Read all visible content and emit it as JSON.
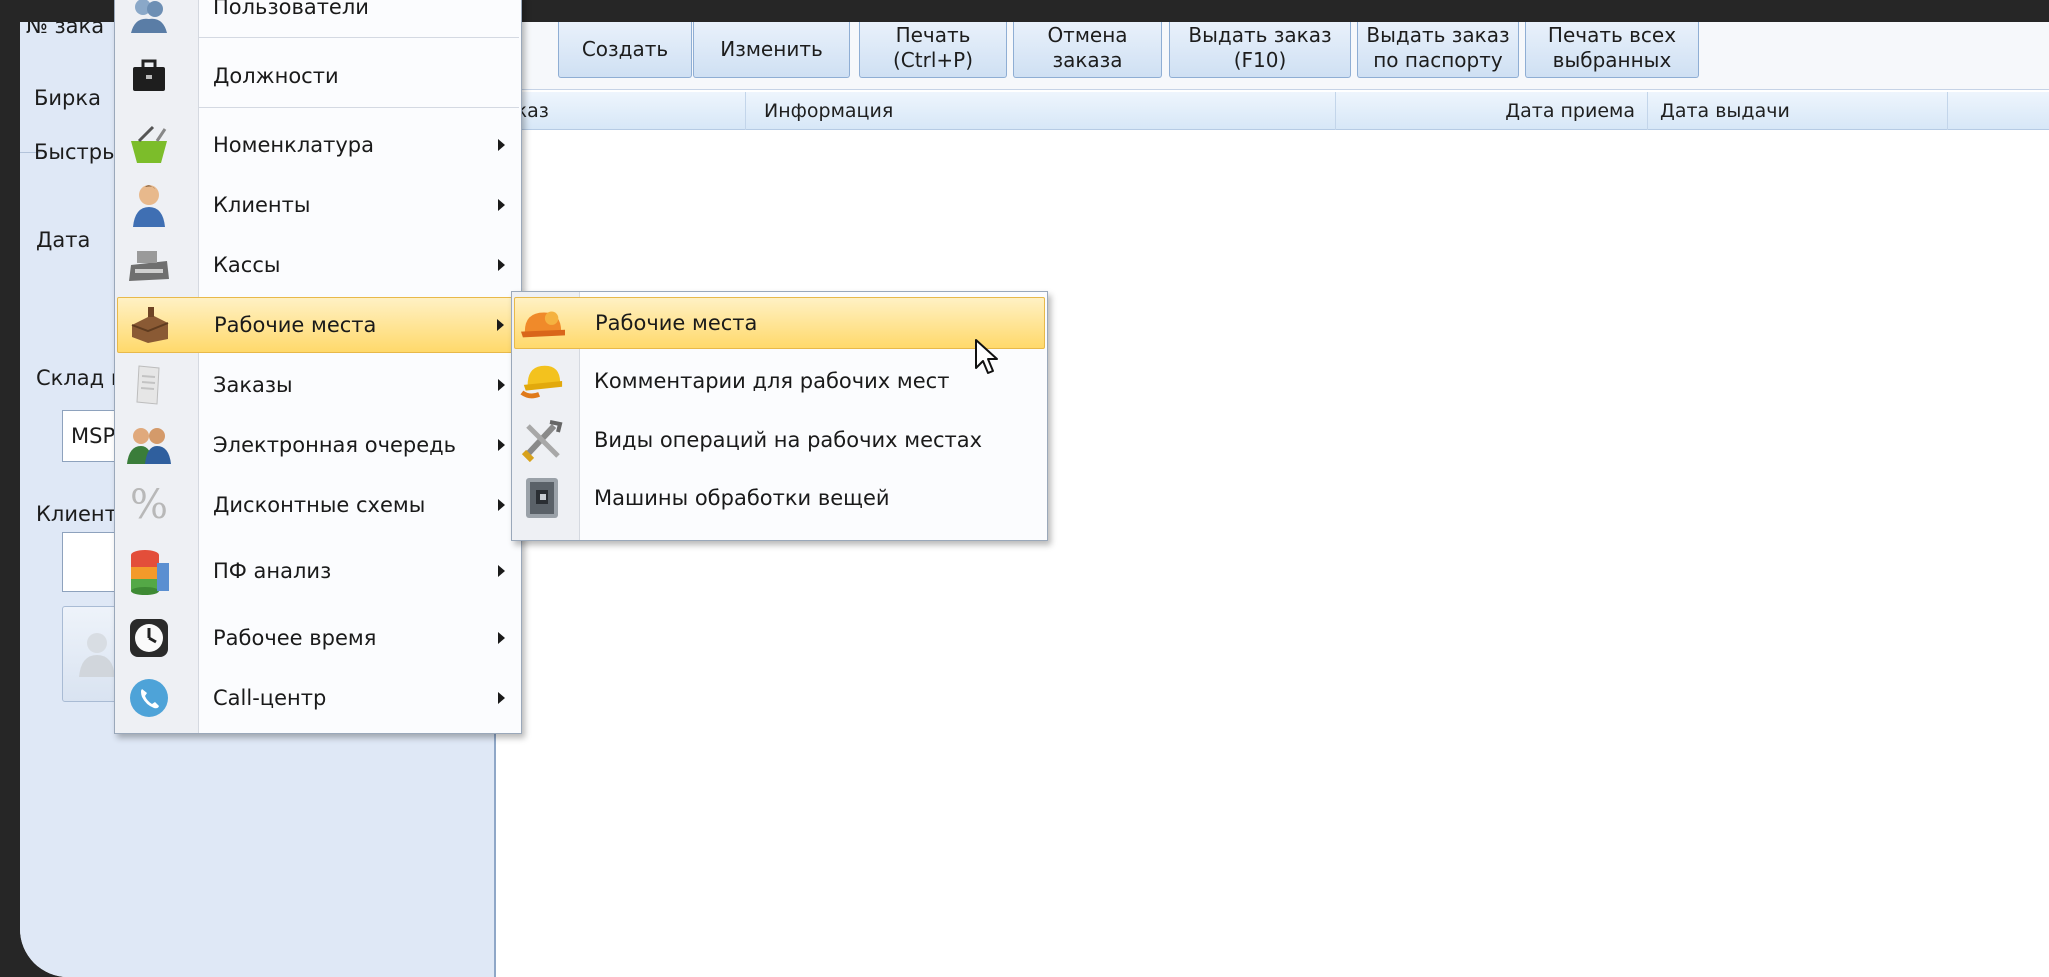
{
  "left_panel": {
    "order_no_label": "№ зака",
    "tag_label": "Бирка",
    "quick_label": "Быстры",
    "date_label": "Дата",
    "warehouse_label": "Склад п",
    "warehouse_value": "MSP",
    "client_label": "Клиент"
  },
  "toolbar": {
    "buttons": [
      {
        "label": "Создать"
      },
      {
        "label": "Изменить"
      },
      {
        "label": "Печать\n(Ctrl+P)"
      },
      {
        "label": "Отмена\nзаказа"
      },
      {
        "label": "Выдать заказ\n(F10)"
      },
      {
        "label": "Выдать заказ\nпо паспорту"
      },
      {
        "label": "Печать всех\nвыбранных"
      }
    ]
  },
  "grid": {
    "columns": [
      "аказ",
      "Информация",
      "Дата приема",
      "Дата выдачи"
    ]
  },
  "main_menu": {
    "items": [
      {
        "label": "Пользователи",
        "icon": "users-icon",
        "submenu": false
      },
      {
        "label": "Должности",
        "icon": "briefcase-icon",
        "submenu": false
      },
      {
        "label": "Номенклатура",
        "icon": "basket-icon",
        "submenu": true
      },
      {
        "label": "Клиенты",
        "icon": "client-icon",
        "submenu": true
      },
      {
        "label": "Кассы",
        "icon": "cash-register-icon",
        "submenu": true
      },
      {
        "label": "Рабочие места",
        "icon": "workplace-icon",
        "submenu": true,
        "highlighted": true
      },
      {
        "label": "Заказы",
        "icon": "document-icon",
        "submenu": true
      },
      {
        "label": "Электронная очередь",
        "icon": "queue-people-icon",
        "submenu": true
      },
      {
        "label": "Дисконтные схемы",
        "icon": "percent-icon",
        "submenu": true
      },
      {
        "label": "ПФ анализ",
        "icon": "database-chart-icon",
        "submenu": true
      },
      {
        "label": "Рабочее время",
        "icon": "clock-icon",
        "submenu": true
      },
      {
        "label": "Call-центр",
        "icon": "phone-icon",
        "submenu": true
      }
    ]
  },
  "sub_menu": {
    "items": [
      {
        "label": "Рабочие места",
        "icon": "hardhat-icon",
        "highlighted": true
      },
      {
        "label": "Комментарии для рабочих мест",
        "icon": "hardhat-yellow-icon"
      },
      {
        "label": "Виды операций на рабочих местах",
        "icon": "tools-icon"
      },
      {
        "label": "Машины обработки вещей",
        "icon": "machine-icon"
      }
    ]
  },
  "colors": {
    "panel_bg": "#dfe8f6",
    "highlight": "#ffd96b",
    "button_border": "#8faed4"
  }
}
